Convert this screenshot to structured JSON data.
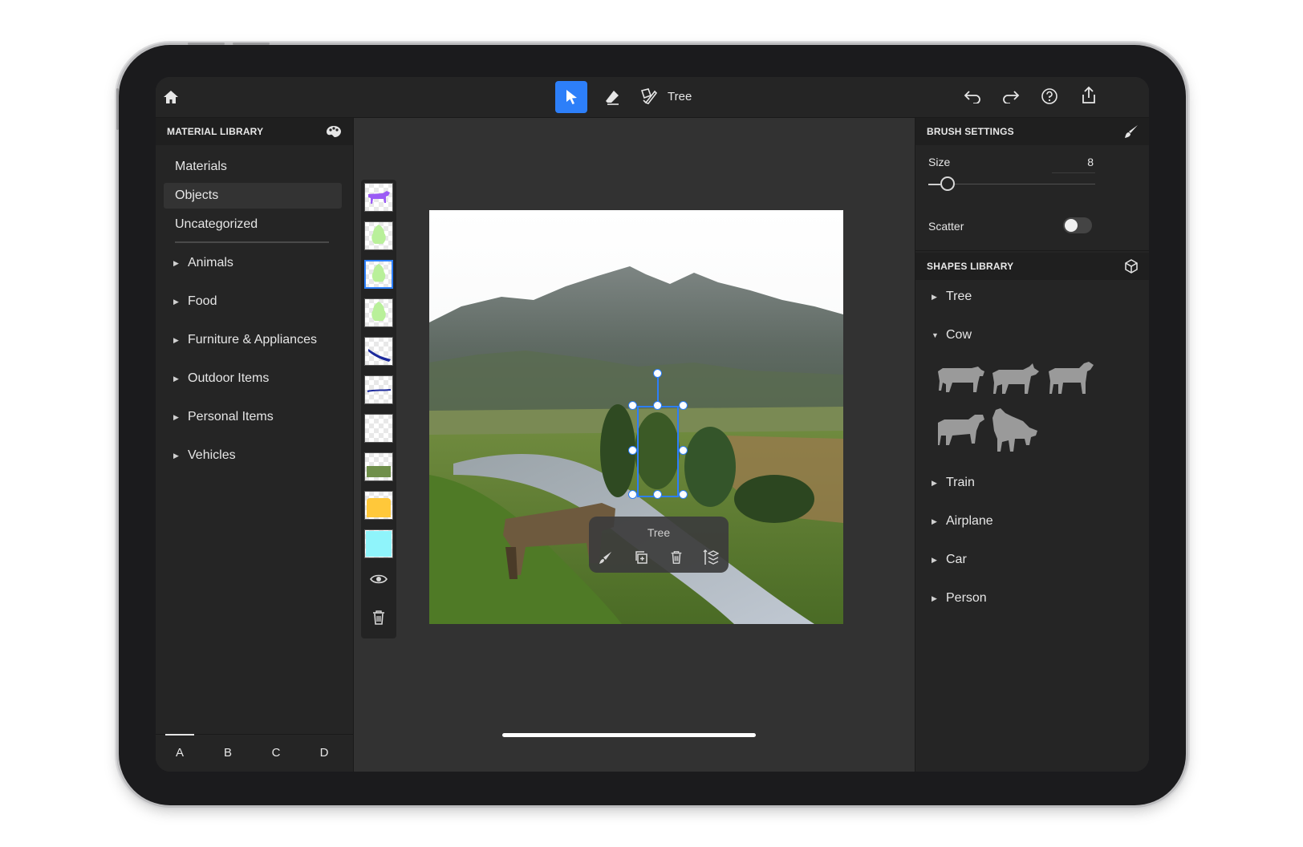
{
  "toolbar": {
    "object_label": "Tree"
  },
  "material_library": {
    "title": "MATERIAL LIBRARY",
    "nav": [
      {
        "label": "Materials",
        "selected": false
      },
      {
        "label": "Objects",
        "selected": true
      },
      {
        "label": "Uncategorized",
        "selected": false
      }
    ],
    "categories": [
      "Animals",
      "Food",
      "Furniture & Appliances",
      "Outdoor Items",
      "Personal Items",
      "Vehicles"
    ],
    "tabs": [
      "A",
      "B",
      "C",
      "D"
    ],
    "active_tab": "A"
  },
  "layers": [
    {
      "kind": "cow",
      "color": "#9b5cf5"
    },
    {
      "kind": "tree",
      "color": "#b9f09a"
    },
    {
      "kind": "tree",
      "color": "#b9f09a",
      "selected": true
    },
    {
      "kind": "tree",
      "color": "#b9f09a"
    },
    {
      "kind": "river",
      "color": "#1c2a9c"
    },
    {
      "kind": "line",
      "color": "#1c2a9c"
    },
    {
      "kind": "empty",
      "color": ""
    },
    {
      "kind": "grass",
      "color": "#6f8f4a"
    },
    {
      "kind": "sand",
      "color": "#ffc83a"
    },
    {
      "kind": "sky",
      "color": "#8ff4fb"
    }
  ],
  "context_popup": {
    "title": "Tree"
  },
  "brush_settings": {
    "title": "BRUSH SETTINGS",
    "size_label": "Size",
    "size_value": "8",
    "size_fraction": 0.08,
    "scatter_label": "Scatter",
    "scatter_on": false
  },
  "shapes_library": {
    "title": "SHAPES LIBRARY",
    "items": [
      {
        "label": "Tree",
        "expanded": false
      },
      {
        "label": "Cow",
        "expanded": true
      },
      {
        "label": "Train",
        "expanded": false
      },
      {
        "label": "Airplane",
        "expanded": false
      },
      {
        "label": "Car",
        "expanded": false
      },
      {
        "label": "Person",
        "expanded": false
      }
    ]
  },
  "colors": {
    "accent": "#2d7ff9",
    "panel": "#252525",
    "canvas_bg": "#323232"
  }
}
